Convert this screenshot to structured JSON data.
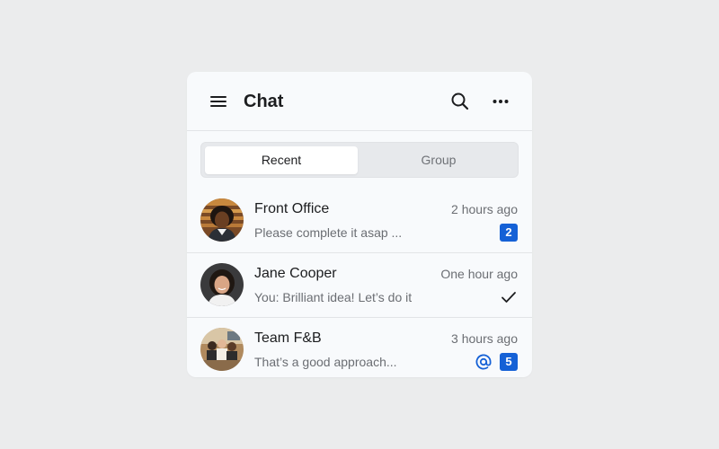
{
  "header": {
    "title": "Chat",
    "menu_icon": "hamburger-menu-icon",
    "search_icon": "search-icon",
    "more_icon": "more-horizontal-icon"
  },
  "tabs": [
    {
      "label": "Recent",
      "active": true
    },
    {
      "label": "Group",
      "active": false
    }
  ],
  "chats": [
    {
      "name": "Front Office",
      "time": "2 hours ago",
      "preview": "Please complete it asap ...",
      "unread": "2",
      "avatar": "person-photo"
    },
    {
      "name": "Jane Cooper",
      "time": "One hour ago",
      "preview": "You: Brilliant idea! Let’s do it",
      "status_icon": "check-icon",
      "avatar": "person-photo"
    },
    {
      "name": "Team F&B",
      "time": "3 hours ago",
      "preview": "That’s a good approach...",
      "mention_icon": "at-mention-icon",
      "unread": "5",
      "avatar": "group-photo"
    }
  ],
  "colors": {
    "background": "#ebeced",
    "card": "#f8fafc",
    "accent": "#1561d6",
    "text_primary": "#1c1d1f",
    "text_secondary": "#6b6e73"
  }
}
